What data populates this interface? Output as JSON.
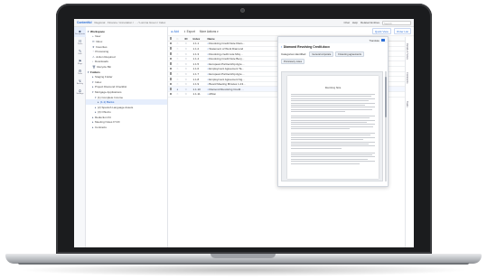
{
  "app": {
    "brand": "Contentful",
    "breadcrumbs": "Regional · Finance / Annotation / … / Lumina Green / Index",
    "top_actions": [
      "Chat",
      "Help",
      "Related Entities"
    ],
    "search_placeholder": "Search",
    "icon_nav": [
      {
        "icon": "■",
        "label": "Documents"
      },
      {
        "icon": "☷",
        "label": "Tasks"
      },
      {
        "icon": "✎",
        "label": "Edit"
      },
      {
        "icon": "⚑",
        "label": "Flags"
      },
      {
        "icon": "⚙",
        "label": "Tools"
      },
      {
        "icon": "↯",
        "label": "Activity"
      },
      {
        "icon": "⛭",
        "label": "Settings"
      }
    ]
  },
  "sidebar": {
    "items": [
      {
        "label": "Workspace",
        "icon": "▾",
        "type": "sec"
      },
      {
        "label": "New",
        "icon": "+",
        "type": "l1"
      },
      {
        "label": "Inbox",
        "icon": "✉",
        "type": "l1"
      },
      {
        "label": "Favorites",
        "icon": "★",
        "type": "l1"
      },
      {
        "label": "Processing",
        "icon": "◔",
        "type": "l1"
      },
      {
        "label": "Action Required",
        "icon": "⚠",
        "type": "l1"
      },
      {
        "label": "Downloads",
        "icon": "↓",
        "type": "l1"
      },
      {
        "label": "Recycle Bin",
        "icon": "🗑",
        "type": "l1"
      },
      {
        "label": "Folders",
        "icon": "▾",
        "type": "sec"
      },
      {
        "label": "Staging Folder",
        "icon": "▸",
        "type": "l1"
      },
      {
        "label": "Index",
        "icon": "▾",
        "type": "l1"
      },
      {
        "label": "Project Diamond Checklist",
        "icon": "▸",
        "type": "l1"
      },
      {
        "label": "Mortgage Applications",
        "icon": "▾",
        "type": "l1"
      },
      {
        "label": "(1) Complete Income",
        "icon": "▾",
        "type": "l2"
      },
      {
        "label": "(1.1) Banks",
        "icon": "▸",
        "type": "l3",
        "selected": true
      },
      {
        "label": "(2) Spanish Language Assets",
        "icon": "▸",
        "type": "l2"
      },
      {
        "label": "(3) Ohio/co",
        "icon": "▸",
        "type": "l2"
      },
      {
        "label": "Reduction Kit",
        "icon": "▸",
        "type": "l1"
      },
      {
        "label": "Meeting Notes FY20",
        "icon": "▸",
        "type": "l1"
      },
      {
        "label": "Contracts",
        "icon": "▸",
        "type": "l1"
      }
    ]
  },
  "toolbar": {
    "add_label": "Add",
    "export_label": "Export",
    "more_label": "More Actions",
    "view_tools": [
      "Quick View",
      "Order List"
    ]
  },
  "table": {
    "headers": [
      "",
      "ID",
      "Index",
      "Name",
      "Type",
      "Status",
      "Category"
    ],
    "rows": [
      {
        "index": "1.1.1",
        "name": "Revolving Credit Note Diam…",
        "type": "",
        "status": "",
        "category": ""
      },
      {
        "index": "1.1.2",
        "name": "Statement of Work Diamond",
        "type": "",
        "status": "",
        "category": ""
      },
      {
        "index": "1.1.3",
        "name": "Revolving credit note Mcq…",
        "type": "",
        "status": "",
        "category": ""
      },
      {
        "index": "1.1.4",
        "name": "Revolving Credit Note Benj…",
        "type": "",
        "status": "",
        "category": ""
      },
      {
        "index": "1.1.5",
        "name": "European Partnership Agre…",
        "type": "",
        "status": "",
        "category": ""
      },
      {
        "index": "1.1.6",
        "name": "Employment Agreement Ta…",
        "type": "",
        "status": "",
        "category": ""
      },
      {
        "index": "1.1.7",
        "name": "European Partnership Agre…",
        "type": "",
        "status": "",
        "category": ""
      },
      {
        "index": "1.1.8",
        "name": "Employment Agreement Ng…",
        "type": "",
        "status": "",
        "category": ""
      },
      {
        "index": "1.1.9",
        "name": "Board Meeting Minutes 1-13…",
        "type": "",
        "status": "",
        "category": ""
      },
      {
        "index": "1.1.10",
        "name": "Diamond Revolving Credit …",
        "type": "",
        "status": "",
        "category": "",
        "selected": true
      },
      {
        "index": "1.1.11",
        "name": "Affton",
        "type": "docx",
        "status": "Published",
        "category": "Commercial"
      }
    ]
  },
  "popup": {
    "translate_label": "Translate",
    "title": "Diamond Revolving Credit.docx",
    "categories_label": "Categories identified",
    "chips": [
      "General corporate",
      "Financing agreements",
      "Promissory notes"
    ],
    "doc_heading": "Revolving Note"
  },
  "right_rail": [
    "Details & Notes",
    "Comments",
    "Tasks"
  ]
}
